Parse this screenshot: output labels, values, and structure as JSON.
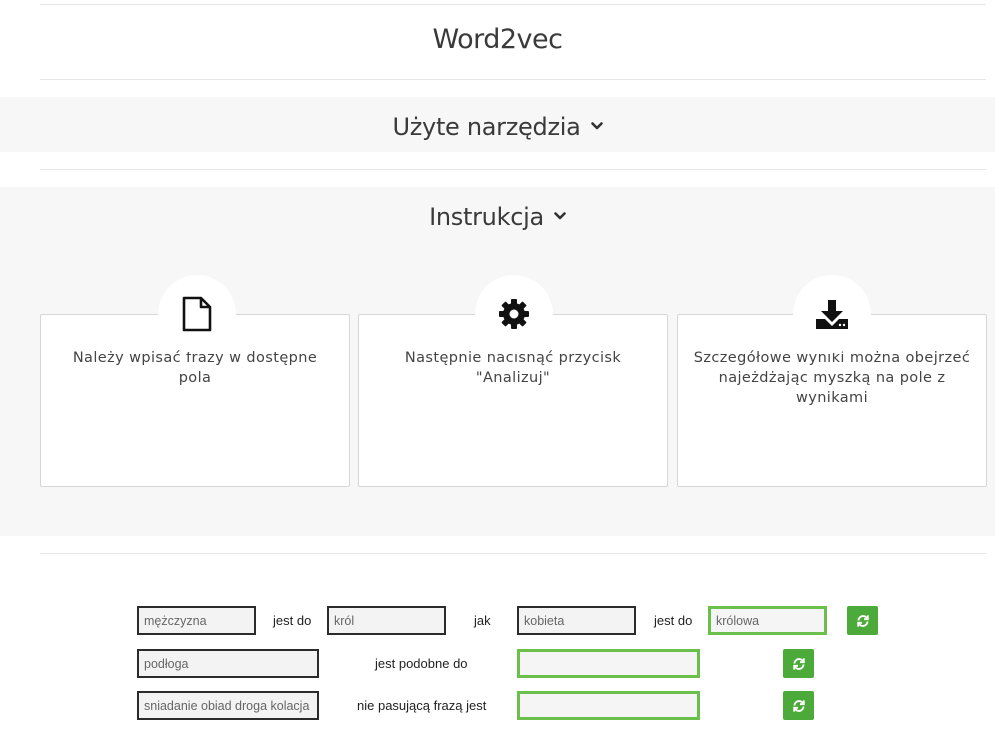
{
  "header": {
    "title": "Word2vec"
  },
  "sections": {
    "tools": {
      "label": "Użyte narzędzia",
      "icon": "chevron-down-icon"
    },
    "instructions": {
      "label": "Instrukcja",
      "icon": "chevron-down-icon"
    }
  },
  "steps": [
    {
      "icon": "file-icon",
      "text": "Należy wpisać frazy w dostępne pola"
    },
    {
      "icon": "gear-icon",
      "text": "Następnie nacisnąć przycisk \"Analizuj\""
    },
    {
      "icon": "download-icon",
      "text": "Szczegółowe wyniki można obejrzeć najeżdżając myszką na pole z wynikami"
    }
  ],
  "analogy": {
    "a_value": "mężczyzna",
    "is_to_1": "jest do",
    "b_value": "król",
    "as": "jak",
    "c_value": "kobieta",
    "is_to_2": "jest do",
    "result_value": "królowa"
  },
  "similar": {
    "input_value": "podłoga",
    "label": "jest podobne do",
    "result_value": ""
  },
  "odd_one_out": {
    "input_value": "sniadanie obiad droga kolacja",
    "label": "nie pasującą frazą jest",
    "result_value": ""
  },
  "colors": {
    "accent_green": "#4caa3a",
    "result_border": "#6bc04b",
    "band": "#f7f7f7"
  },
  "refresh_icon": "refresh-icon"
}
